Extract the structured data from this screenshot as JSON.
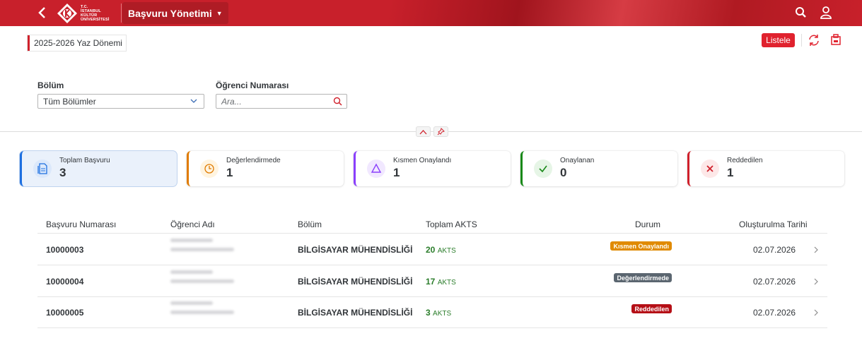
{
  "header": {
    "logo_lines": [
      "T.C.",
      "İSTANBUL",
      "KÜLTÜR",
      "ÜNİVERSİTESİ"
    ],
    "app_title": "Başvuru Yönetimi",
    "icons": [
      "back-icon",
      "search-icon",
      "user-icon"
    ]
  },
  "toolbar": {
    "variant": "2025-2026 Yaz Dönemi",
    "listele_label": "Listele",
    "icons": [
      "refresh-icon",
      "export-icon"
    ]
  },
  "filters": {
    "department_label": "Bölüm",
    "department_value": "Tüm Bölümler",
    "student_number_label": "Öğrenci Numarası",
    "student_number_placeholder": "Ara..."
  },
  "kpis": [
    {
      "title": "Toplam Başvuru",
      "value": "3",
      "color": "#1d6fe0",
      "icon": "document-icon"
    },
    {
      "title": "Değerlendirmede",
      "value": "1",
      "color": "#e07b00",
      "icon": "clock-icon"
    },
    {
      "title": "Kısmen Onaylandı",
      "value": "1",
      "color": "#8a3ffc",
      "icon": "triangle-icon"
    },
    {
      "title": "Onaylanan",
      "value": "0",
      "color": "#188918",
      "icon": "check-icon"
    },
    {
      "title": "Reddedilen",
      "value": "1",
      "color": "#d0202b",
      "icon": "cross-icon"
    }
  ],
  "table": {
    "columns": [
      "Başvuru Numarası",
      "Öğrenci Adı",
      "Bölüm",
      "Toplam AKTS",
      "Durum",
      "Oluşturulma Tarihi"
    ],
    "akts_unit": "AKTS",
    "rows": [
      {
        "number": "10000003",
        "department": "BİLGİSAYAR MÜHENDİSLİĞİ",
        "akts": "20",
        "status": "Kısmen Onaylandı",
        "status_color": "#e08a00",
        "date": "02.07.2026"
      },
      {
        "number": "10000004",
        "department": "BİLGİSAYAR MÜHENDİSLİĞİ",
        "akts": "17",
        "status": "Değerlendirmede",
        "status_color": "#5b6670",
        "date": "02.07.2026"
      },
      {
        "number": "10000005",
        "department": "BİLGİSAYAR MÜHENDİSLİĞİ",
        "akts": "3",
        "status": "Reddedilen",
        "status_color": "#b50f16",
        "date": "02.07.2026"
      }
    ]
  }
}
